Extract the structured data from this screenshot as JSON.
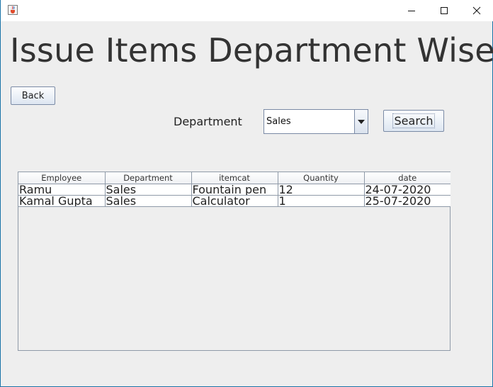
{
  "window": {
    "icon": "java-cup-icon",
    "controls": {
      "minimize": "minimize-icon",
      "maximize": "maximize-icon",
      "close": "close-icon"
    }
  },
  "page": {
    "title": "Issue Items Department Wise"
  },
  "back_button": {
    "label": "Back"
  },
  "filter": {
    "department_label": "Department",
    "department_value": "Sales",
    "search_label": "Search"
  },
  "table": {
    "columns": [
      "Employee",
      "Department",
      "itemcat",
      "Quantity",
      "date"
    ],
    "rows": [
      [
        "Ramu",
        "Sales",
        "Fountain pen",
        "12",
        "24-07-2020"
      ],
      [
        "Kamal Gupta",
        "Sales",
        "Calculator",
        "1",
        "25-07-2020"
      ]
    ]
  },
  "colors": {
    "window_border": "#1a73a8",
    "background": "#eeeeee",
    "button_border": "#7a8aa5"
  }
}
